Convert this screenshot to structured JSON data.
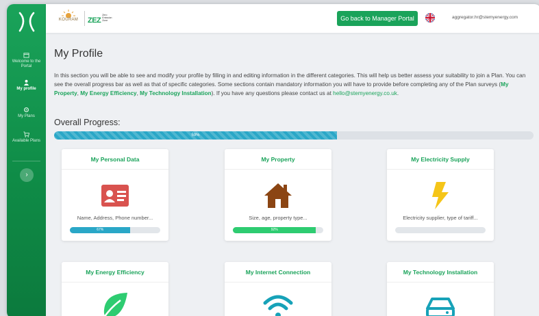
{
  "sidebar": {
    "items": [
      {
        "label": "Welcome to the Portal",
        "icon": "calendar-icon"
      },
      {
        "label": "My profile",
        "icon": "user-icon"
      },
      {
        "label": "My Plans",
        "icon": "settings-icon"
      },
      {
        "label": "Available Plans",
        "icon": "cart-icon"
      }
    ],
    "toggle": "›"
  },
  "header": {
    "brand_left": "KOURAM",
    "brand_right": "ZEZ",
    "brand_right_sub": "Zero Emission Zone",
    "portal_button": "Go back to Manager Portal",
    "user_email": "aggregator.hr@stemyenergy.com"
  },
  "page": {
    "title": "My Profile",
    "intro_1": "In this section you will be able to see and modify your profile by filling in and editing information in the different categories. This will help us better assess your suitability to join a Plan. You can see the overall progress bar as well as that of specific categories. Some sections contain mandatory information you will have to provide before completing any of the Plan surveys (",
    "link_property": "My Property",
    "link_efficiency": "My Energy Efficiency",
    "link_technology": "My Technology Installation",
    "intro_2": "). If you have any questions please contact us at",
    "contact_email": "hello@stemyenergy.co.uk",
    "progress_title": "Overall Progress:",
    "overall_progress": 0.59,
    "overall_label": "59%"
  },
  "cards": [
    {
      "title": "My Personal Data",
      "desc": "Name, Address, Phone number...",
      "progress": 0.67,
      "progress_label": "67%",
      "icon": "id-card-icon",
      "color": "#d9534f",
      "bar_color": "#2aa7c7"
    },
    {
      "title": "My Property",
      "desc": "Size, age, property type...",
      "progress": 0.92,
      "progress_label": "92%",
      "icon": "house-icon",
      "color": "#8b4513",
      "bar_color": "#2ecc71"
    },
    {
      "title": "My Electricity Supply",
      "desc": "Electricity supplier, type of tariff...",
      "progress": 0,
      "progress_label": "",
      "icon": "lightning-icon",
      "color": "#f5c518",
      "bar_color": "#2aa7c7"
    },
    {
      "title": "My Energy Efficiency",
      "icon": "leaf-icon",
      "color": "#2ecc71"
    },
    {
      "title": "My Internet Connection",
      "icon": "wifi-icon",
      "color": "#17a2b8"
    },
    {
      "title": "My Technology Installation",
      "icon": "server-icon",
      "color": "#17a2b8"
    }
  ]
}
